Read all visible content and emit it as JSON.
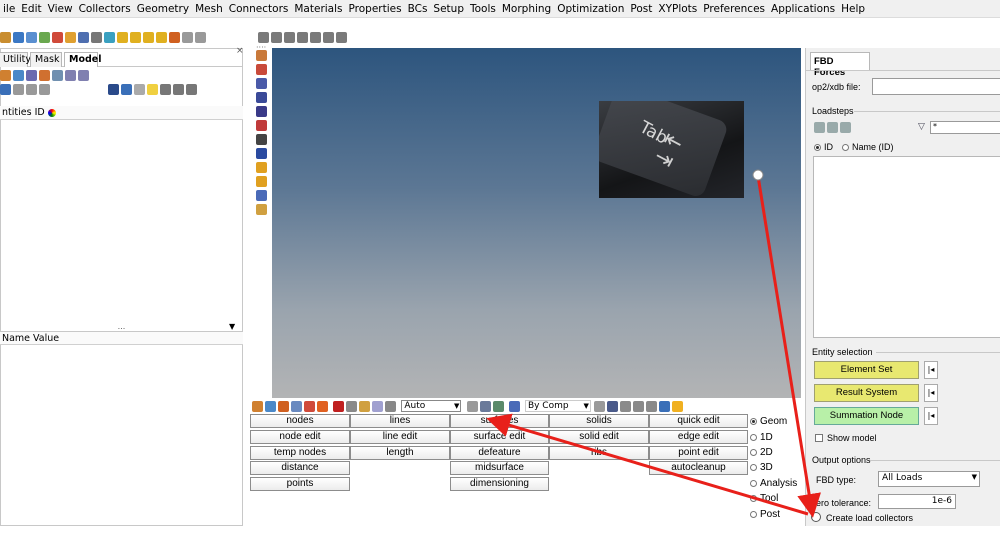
{
  "menu": [
    "ile",
    "Edit",
    "View",
    "Collectors",
    "Geometry",
    "Mesh",
    "Connectors",
    "Materials",
    "Properties",
    "BCs",
    "Setup",
    "Tools",
    "Morphing",
    "Optimization",
    "Post",
    "XYPlots",
    "Preferences",
    "Applications",
    "Help"
  ],
  "left_panel": {
    "tabs": [
      "Utility",
      "Mask",
      "Model"
    ],
    "close_label": "×",
    "entities_header": "ntities ID",
    "splitter_label": "...",
    "attributes_header": "Name Value"
  },
  "bottom_toolbar": {
    "auto_value": "Auto",
    "bycomp_label": "By Comp"
  },
  "buttons": {
    "col1": [
      "nodes",
      "node edit",
      "temp nodes",
      "distance",
      "points"
    ],
    "col2": [
      "lines",
      "line edit",
      "length"
    ],
    "col3": [
      "surfaces",
      "surface edit",
      "defeature",
      "midsurface",
      "dimensioning"
    ],
    "col4": [
      "solids",
      "solid edit",
      "ribs"
    ],
    "col5": [
      "quick edit",
      "edge edit",
      "point edit",
      "autocleanup"
    ]
  },
  "modes": {
    "items": [
      "Geom",
      "1D",
      "2D",
      "3D",
      "Analysis",
      "Tool",
      "Post"
    ],
    "selected": "Geom"
  },
  "right_panel": {
    "tab_label": "FBD Forces",
    "file_label": "op2/xdb file:",
    "file_value": "",
    "loadsteps_label": "Loadsteps",
    "filter_value": "*",
    "id_option": "ID",
    "name_option": "Name (ID)",
    "entity_selection_label": "Entity selection",
    "element_set": "Element Set",
    "result_system": "Result System",
    "summation_node": "Summation Node",
    "side_button_label": "|◂",
    "show_model": "Show model",
    "output_options_label": "Output options",
    "fbd_type_label": "FBD type:",
    "fbd_type_value": "All Loads",
    "zero_tolerance_label": "ero tolerance:",
    "zero_tolerance_value": "1e-6",
    "create_load_collectors": "Create load collectors"
  },
  "viewport": {
    "photo_key_label": "Tab"
  },
  "colors": {
    "annotation_arrow": "#e8201a",
    "yellow_button": "#e8e870",
    "selected_button": "#b8f0a8"
  }
}
